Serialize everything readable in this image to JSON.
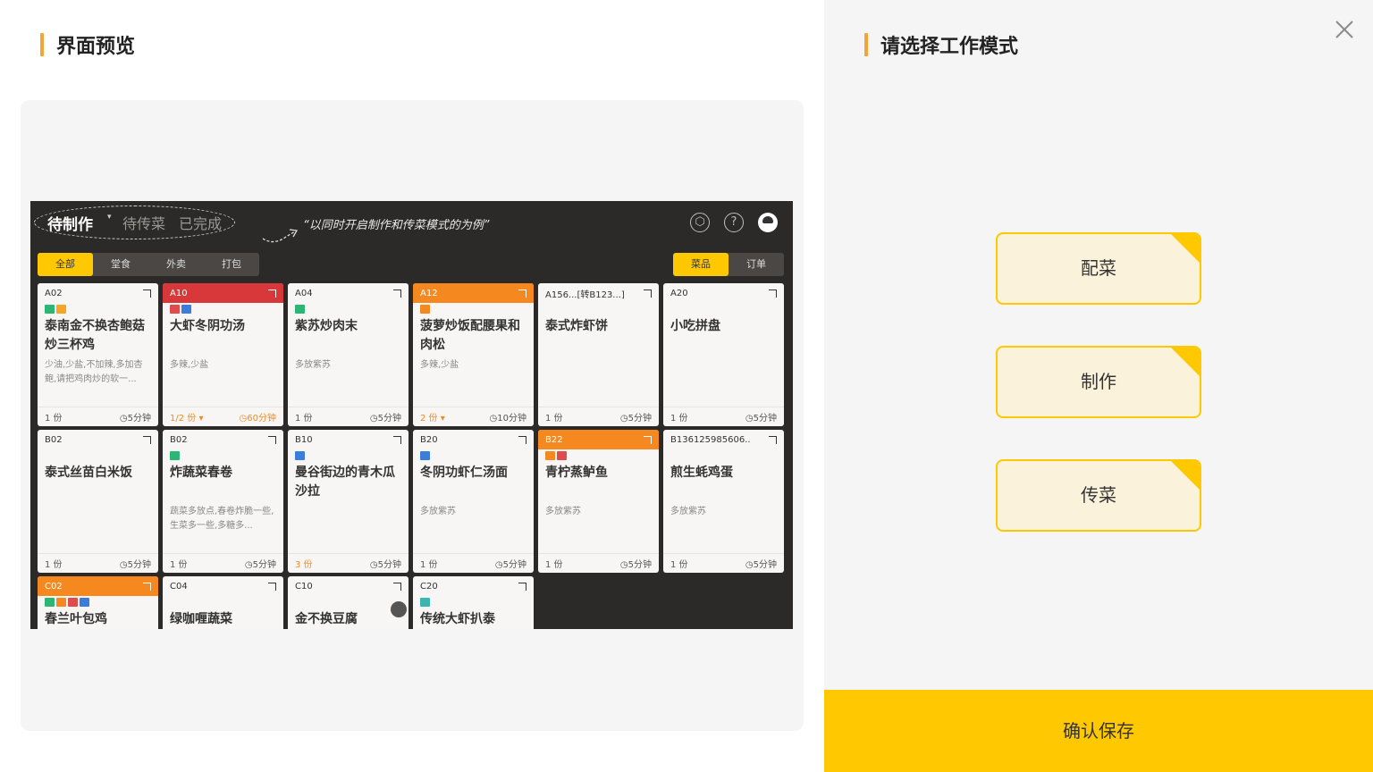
{
  "preview": {
    "title": "界面预览",
    "screen": {
      "tabs": [
        "待制作",
        "待传菜",
        "已完成"
      ],
      "note": "“以同时开启制作和传菜模式的为例”",
      "filters": [
        "全部",
        "堂食",
        "外卖",
        "打包"
      ],
      "view_toggle": [
        "菜品",
        "订单"
      ],
      "cards": [
        {
          "id": "A02",
          "style": "normal",
          "tags": [
            "g",
            "y"
          ],
          "name": "泰南金不换杏鲍菇炒三杯鸡",
          "note": "少油,少盐,不加辣,多加杏鲍,请把鸡肉炒的软一...",
          "qty": "1 份",
          "time": "◷5分钟"
        },
        {
          "id": "A10",
          "style": "red",
          "tags": [
            "r",
            "b"
          ],
          "name": "大虾冬阴功汤",
          "note": "多辣,少盐",
          "qty": "1/2 份 ▾",
          "time": "◷60分钟"
        },
        {
          "id": "A04",
          "style": "normal",
          "tags": [
            "g"
          ],
          "name": "紫苏炒肉末",
          "note": "多放紫苏",
          "qty": "1 份",
          "time": "◷5分钟"
        },
        {
          "id": "A12",
          "style": "orange",
          "tags": [
            "o"
          ],
          "name": "菠萝炒饭配腰果和肉松",
          "note": "多辣,少盐",
          "qty": "2 份 ▾",
          "time": "◷10分钟"
        },
        {
          "id": "A156...[转B123...]",
          "style": "normal",
          "tags": [],
          "name": "泰式炸虾饼",
          "note": "",
          "qty": "1 份",
          "time": "◷5分钟"
        },
        {
          "id": "A20",
          "style": "normal",
          "tags": [],
          "name": "小吃拼盘",
          "note": "",
          "qty": "1 份",
          "time": "◷5分钟"
        },
        {
          "id": "B02",
          "style": "normal",
          "tags": [],
          "name": "泰式丝苗白米饭",
          "note": "",
          "qty": "1 份",
          "time": "◷5分钟"
        },
        {
          "id": "B02",
          "style": "normal",
          "tags": [
            "g"
          ],
          "name": "炸蔬菜春卷",
          "note": "蔬菜多放点,春卷炸脆一些,生菜多一些,多糖多...",
          "qty": "1 份",
          "time": "◷5分钟"
        },
        {
          "id": "B10",
          "style": "normal",
          "tags": [
            "b"
          ],
          "name": "曼谷街边的青木瓜沙拉",
          "note": "",
          "qty": "3 份",
          "time": "◷5分钟"
        },
        {
          "id": "B20",
          "style": "normal",
          "tags": [
            "b"
          ],
          "name": "冬阴功虾仁汤面",
          "note": "多放紫苏",
          "qty": "1 份",
          "time": "◷5分钟"
        },
        {
          "id": "B22",
          "style": "orange",
          "tags": [
            "o",
            "r"
          ],
          "name": "青柠蒸鲈鱼",
          "note": "多放紫苏",
          "qty": "1 份",
          "time": "◷5分钟"
        },
        {
          "id": "B136125985606..",
          "style": "normal",
          "tags": [],
          "name": "煎生蚝鸡蛋",
          "note": "多放紫苏",
          "qty": "1 份",
          "time": "◷5分钟"
        },
        {
          "id": "C02",
          "style": "orange",
          "tags": [
            "g",
            "o",
            "r",
            "b"
          ],
          "name": "春兰叶包鸡",
          "note": "",
          "qty": "",
          "time": ""
        },
        {
          "id": "C04",
          "style": "normal",
          "tags": [],
          "name": "绿咖喱蔬菜",
          "note": "",
          "qty": "",
          "time": ""
        },
        {
          "id": "C10",
          "style": "normal",
          "tags": [],
          "name": "金不换豆腐",
          "note": "",
          "qty": "",
          "time": ""
        },
        {
          "id": "C20",
          "style": "normal",
          "tags": [
            "t"
          ],
          "name": "传统大虾扒泰",
          "note": "",
          "qty": "",
          "time": ""
        }
      ]
    }
  },
  "mode_panel": {
    "title": "请选择工作模式",
    "modes": [
      "配菜",
      "制作",
      "传菜"
    ],
    "save_label": "确认保存"
  },
  "colors": {
    "accent": "#ffc800",
    "title_bar": "#f5a533",
    "mode_bg": "#faf2da",
    "panel_bg": "#f5f5f5"
  }
}
